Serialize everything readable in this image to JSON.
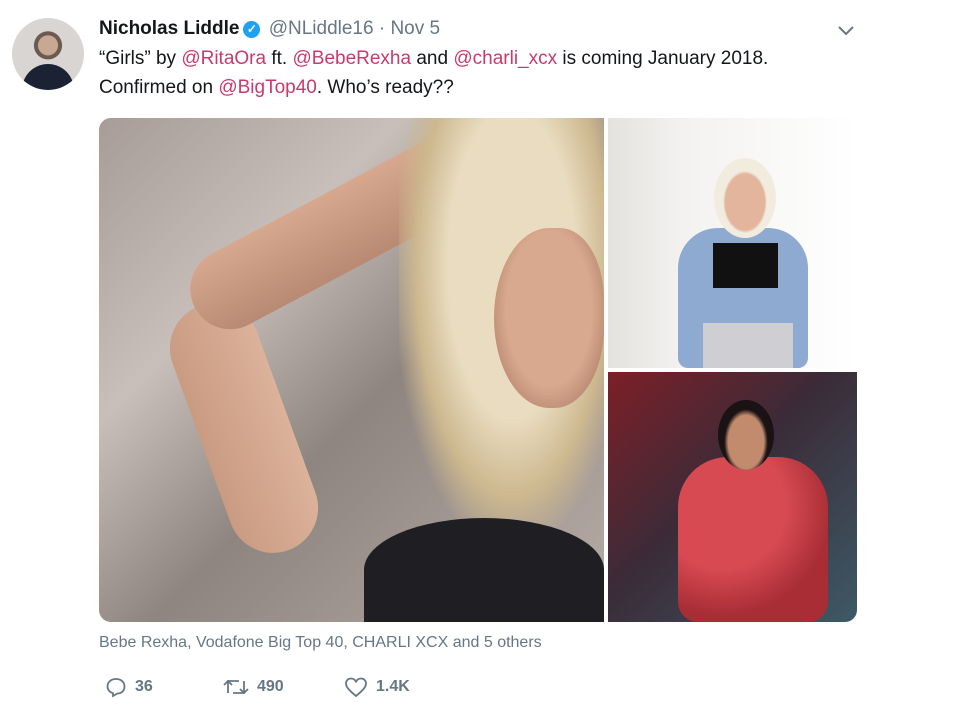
{
  "tweet": {
    "author_name": "Nicholas Liddle",
    "handle": "@NLiddle16",
    "separator": "·",
    "date": "Nov 5",
    "text": {
      "part1": "“Girls” by ",
      "mention1": "@RitaOra",
      "part2": " ft. ",
      "mention2": "@BebeRexha",
      "part3": " and ",
      "mention3": "@charli_xcx",
      "part4": " is coming January 2018. Confirmed on ",
      "mention4": "@BigTop40",
      "part5": ". Who’s ready??"
    },
    "media_tags": "Bebe Rexha, Vodafone Big Top 40, CHARLI XCX and 5 others",
    "actions": {
      "replies": "36",
      "retweets": "490",
      "likes": "1.4K"
    }
  },
  "colors": {
    "mention": "#c93a6b",
    "muted": "#657786",
    "verified": "#1da1f2"
  },
  "icons": [
    "verified-badge-icon",
    "chevron-down-icon",
    "reply-icon",
    "retweet-icon",
    "like-icon"
  ]
}
